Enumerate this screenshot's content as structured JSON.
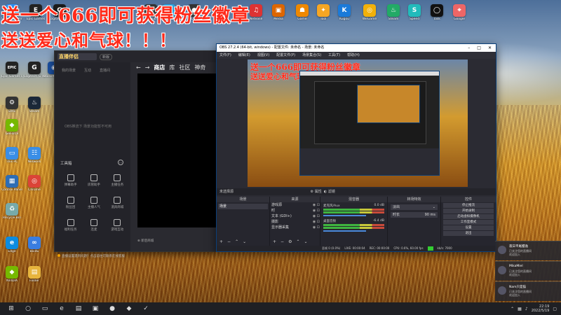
{
  "desktop": {
    "banner_line1": "送一个666即可获得粉丝徽章",
    "banner_line2": "送送爱心和气球！！！",
    "icons_top": [
      {
        "label": "Screen Recorder",
        "glyph": "▶",
        "color": "#2d8cf0"
      },
      {
        "label": "Epic Games",
        "glyph": "E",
        "color": "#222"
      },
      {
        "label": "Logitech G HUB",
        "glyph": "G",
        "color": "#1a1a1a"
      },
      {
        "label": "GitHub",
        "glyph": "◉",
        "color": "#333"
      },
      {
        "label": "Telegram",
        "glyph": "✈",
        "color": "#2aa1da"
      },
      {
        "label": "OBS",
        "glyph": "●",
        "color": "#333"
      },
      {
        "label": "Netease",
        "glyph": "♫",
        "color": "#d33"
      },
      {
        "label": "Media",
        "glyph": "▣",
        "color": "#d60"
      },
      {
        "label": "Game",
        "glyph": "☗",
        "color": "#e80"
      },
      {
        "label": "Tool",
        "glyph": "✦",
        "color": "#f6a623"
      },
      {
        "label": "Kugou",
        "glyph": "K",
        "color": "#1a7ad9"
      },
      {
        "label": "WeGame",
        "glyph": "◎",
        "color": "#f2b10a"
      },
      {
        "label": "Steam",
        "glyph": "♨",
        "color": "#2a6"
      },
      {
        "label": "Speed",
        "glyph": "S",
        "color": "#2bb"
      },
      {
        "label": "Task",
        "glyph": "◯",
        "color": "#111"
      },
      {
        "label": "Google",
        "glyph": "⌖",
        "color": "#e66"
      }
    ],
    "icons_left": [
      {
        "label": "Epic Games Launcher",
        "glyph": "EPIC",
        "color": "#222"
      },
      {
        "label": "Logitech G HUB",
        "glyph": "G",
        "color": "#222"
      },
      {
        "label": "Ubisoft Connect",
        "glyph": "◉",
        "color": "#1b4fa0"
      },
      {
        "label": "DXS",
        "glyph": "⚙",
        "color": "#333"
      },
      {
        "label": "Steam",
        "glyph": "♨",
        "color": "#1b2838"
      },
      {
        "label": "GeForce",
        "glyph": "◆",
        "color": "#76b900"
      },
      {
        "label": "This PC",
        "glyph": "▭",
        "color": "#3a8ee6"
      },
      {
        "label": "Network",
        "glyph": "☷",
        "color": "#3a8ee6"
      },
      {
        "label": "Control Panel",
        "glyph": "▦",
        "color": "#2d6db5"
      },
      {
        "label": "Chrome",
        "glyph": "◎",
        "color": "#db4437"
      },
      {
        "label": "Recycle Bin",
        "glyph": "♻",
        "color": "#7aa"
      },
      {
        "label": "Edge",
        "glyph": "e",
        "color": "#0c8ce0"
      },
      {
        "label": "Baidu",
        "glyph": "∞",
        "color": "#3a7de0"
      },
      {
        "label": "NVIDIA",
        "glyph": "◆",
        "color": "#76b900"
      },
      {
        "label": "Folder",
        "glyph": "▤",
        "color": "#e7b43d"
      }
    ]
  },
  "assistant": {
    "logo": "直播伴侣",
    "tag": "新版",
    "tabs": [
      "我的场景",
      "互动",
      "直播间"
    ],
    "empty_text": "OBS推流下 场景功能暂不可用",
    "tools_title": "工具箱",
    "tools": [
      "弹幕助手",
      "房管助手",
      "主播任务",
      "粉丝团",
      "主播人气",
      "道具商城",
      "福利任务",
      "连麦",
      "游戏互动"
    ],
    "notice": "直播设置遇到问题？点击前往可联系在线客服",
    "store_nav": [
      "商店",
      "库",
      "社区",
      "神奇"
    ],
    "store_foot": "新后商城"
  },
  "obs": {
    "title": "OBS 27.2.4 (64-bit, windows) - 配置文件: 未命名 - 场景: 未命名",
    "menu": [
      "文件(F)",
      "编辑(E)",
      "视图(V)",
      "配置文件(P)",
      "场景集合(S)",
      "工具(T)",
      "帮助(H)"
    ],
    "scene_bar_left": "未选择源",
    "scene_bar_rec": "属性",
    "scene_bar_filter": "滤镜",
    "docks": {
      "scenes": "场景",
      "sources": "来源",
      "mixer": "混音器",
      "transitions": "转场特效",
      "controls": "控件"
    },
    "scene_items": [
      "场景"
    ],
    "source_items": [
      "游戏源",
      "时",
      "文本 (GDI+)",
      "摄影",
      "显示器采集"
    ],
    "mixer_channels": [
      {
        "name": "麦克风/Aux",
        "db": "0.0 dB"
      },
      {
        "name": "桌面音频",
        "db": "-6.4 dB"
      }
    ],
    "transition_rows": [
      {
        "label": "淡出",
        "value": ""
      },
      {
        "label": "时长",
        "value": "90 ms"
      }
    ],
    "controls": [
      "停止推流",
      "开始录制",
      "启动虚拟摄像机",
      "工作室模式",
      "设置",
      "退出"
    ],
    "status": [
      "丢帧 0 (0.0%)",
      "LIVE: 00:00:04",
      "REC: 00:00:00",
      "CPU: 0.6%, 60.00 fps",
      "kb/s: 7000"
    ]
  },
  "notifications": [
    {
      "name": "夜日平尾樱逸",
      "text": "已关注您的直播间\n欢迎加入"
    },
    {
      "name": "MikaMiel",
      "text": "已关注您的直播间\n欢迎加入"
    },
    {
      "name": "Nam只是猫",
      "text": "已关注您的直播间\n欢迎加入"
    }
  ],
  "taskbar": {
    "time": "22:19",
    "date": "2022/5/19"
  }
}
